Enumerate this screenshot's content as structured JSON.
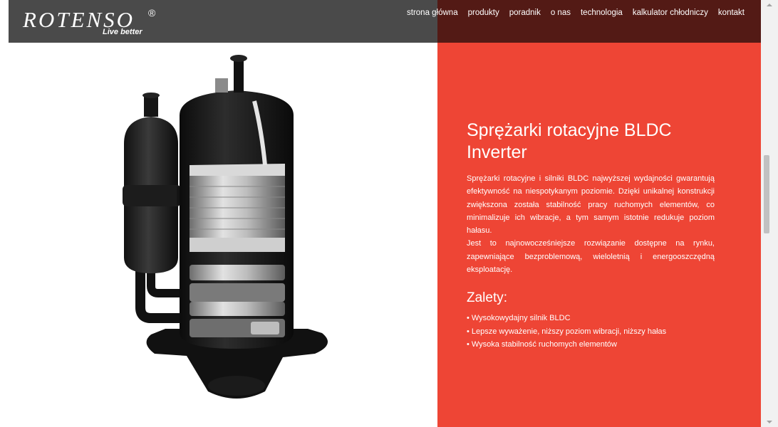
{
  "header": {
    "logo_text": "ROTENSO",
    "logo_reg": "®",
    "tagline": "Live better",
    "nav": [
      {
        "label": "strona główna"
      },
      {
        "label": "produkty"
      },
      {
        "label": "poradnik"
      },
      {
        "label": "o nas"
      },
      {
        "label": "technologia"
      },
      {
        "label": "kalkulator chłodniczy"
      },
      {
        "label": "kontakt"
      }
    ]
  },
  "content": {
    "title": "Sprężarki rotacyjne BLDC Inverter",
    "paragraph1": "Sprężarki rotacyjne i silniki BLDC najwyższej wydajności gwarantują efektywność na niespotykanym poziomie. Dzięki unikalnej konstrukcji zwiększona została stabilność pracy ruchomych elementów, co minimalizuje ich wibracje, a tym samym istotnie redukuje poziom hałasu.",
    "paragraph2": "Jest to najnowocześniejsze rozwiązanie dostępne na rynku, zapewniające bezproblemową, wieloletnią i energooszczędną eksploatację.",
    "advantages_title": "Zalety:",
    "advantages": [
      "Wysokowydajny silnik BLDC",
      "Lepsze wyważenie, niższy poziom wibracji, niższy hałas",
      "Wysoka stabilność ruchomych elementów"
    ],
    "bullet": "•"
  },
  "colors": {
    "accent": "#ee4535",
    "header_left": "#3c3c3c",
    "header_right": "#461612"
  },
  "icons": {
    "product_image": "compressor-cutaway-image"
  }
}
